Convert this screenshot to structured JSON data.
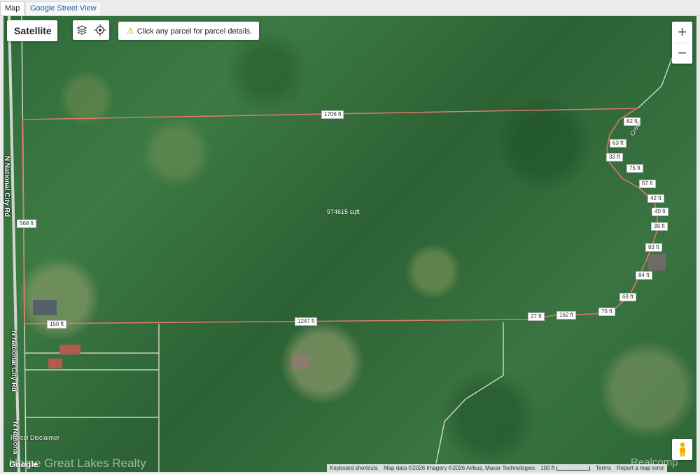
{
  "tabs": [
    {
      "label": "Map",
      "active": true
    },
    {
      "label": "Google Street View",
      "active": false
    }
  ],
  "map_type": {
    "selected": "Satellite"
  },
  "hint": {
    "text": "Click any parcel for parcel details."
  },
  "zoom": {
    "in": "+",
    "out": "−"
  },
  "parcel": {
    "area": "974615 sqft",
    "edges": [
      "1706 ft",
      "82 ft",
      "63 ft",
      "33 ft",
      "75 ft",
      "57 ft",
      "42 ft",
      "40 ft",
      "39 ft",
      "83 ft",
      "84 ft",
      "68 ft",
      "76 ft",
      "162 ft",
      "27 ft",
      "1247 ft",
      "150 ft",
      "568 ft"
    ],
    "outline_color": "#e07a6a"
  },
  "roads": {
    "left_1": "N National City Rd",
    "left_2": "N National City Rd",
    "left_3": "N Nationa"
  },
  "creek": "Creek",
  "map_footer": {
    "shortcuts": "Keyboard shortcuts",
    "attribution": "Map data ©2026 Imagery ©2026 Airbus, Maxar Technologies",
    "scale": "100 ft",
    "terms": "Terms",
    "report": "Report a map error"
  },
  "disclaimer": "Parcel Disclaimer",
  "google": "Google",
  "watermarks": {
    "left": "Home Great Lakes Realty",
    "right": "Realcomp"
  },
  "icons": [
    "layers-icon",
    "locate-icon",
    "warning-icon",
    "pegman-icon",
    "caret-down-icon"
  ]
}
